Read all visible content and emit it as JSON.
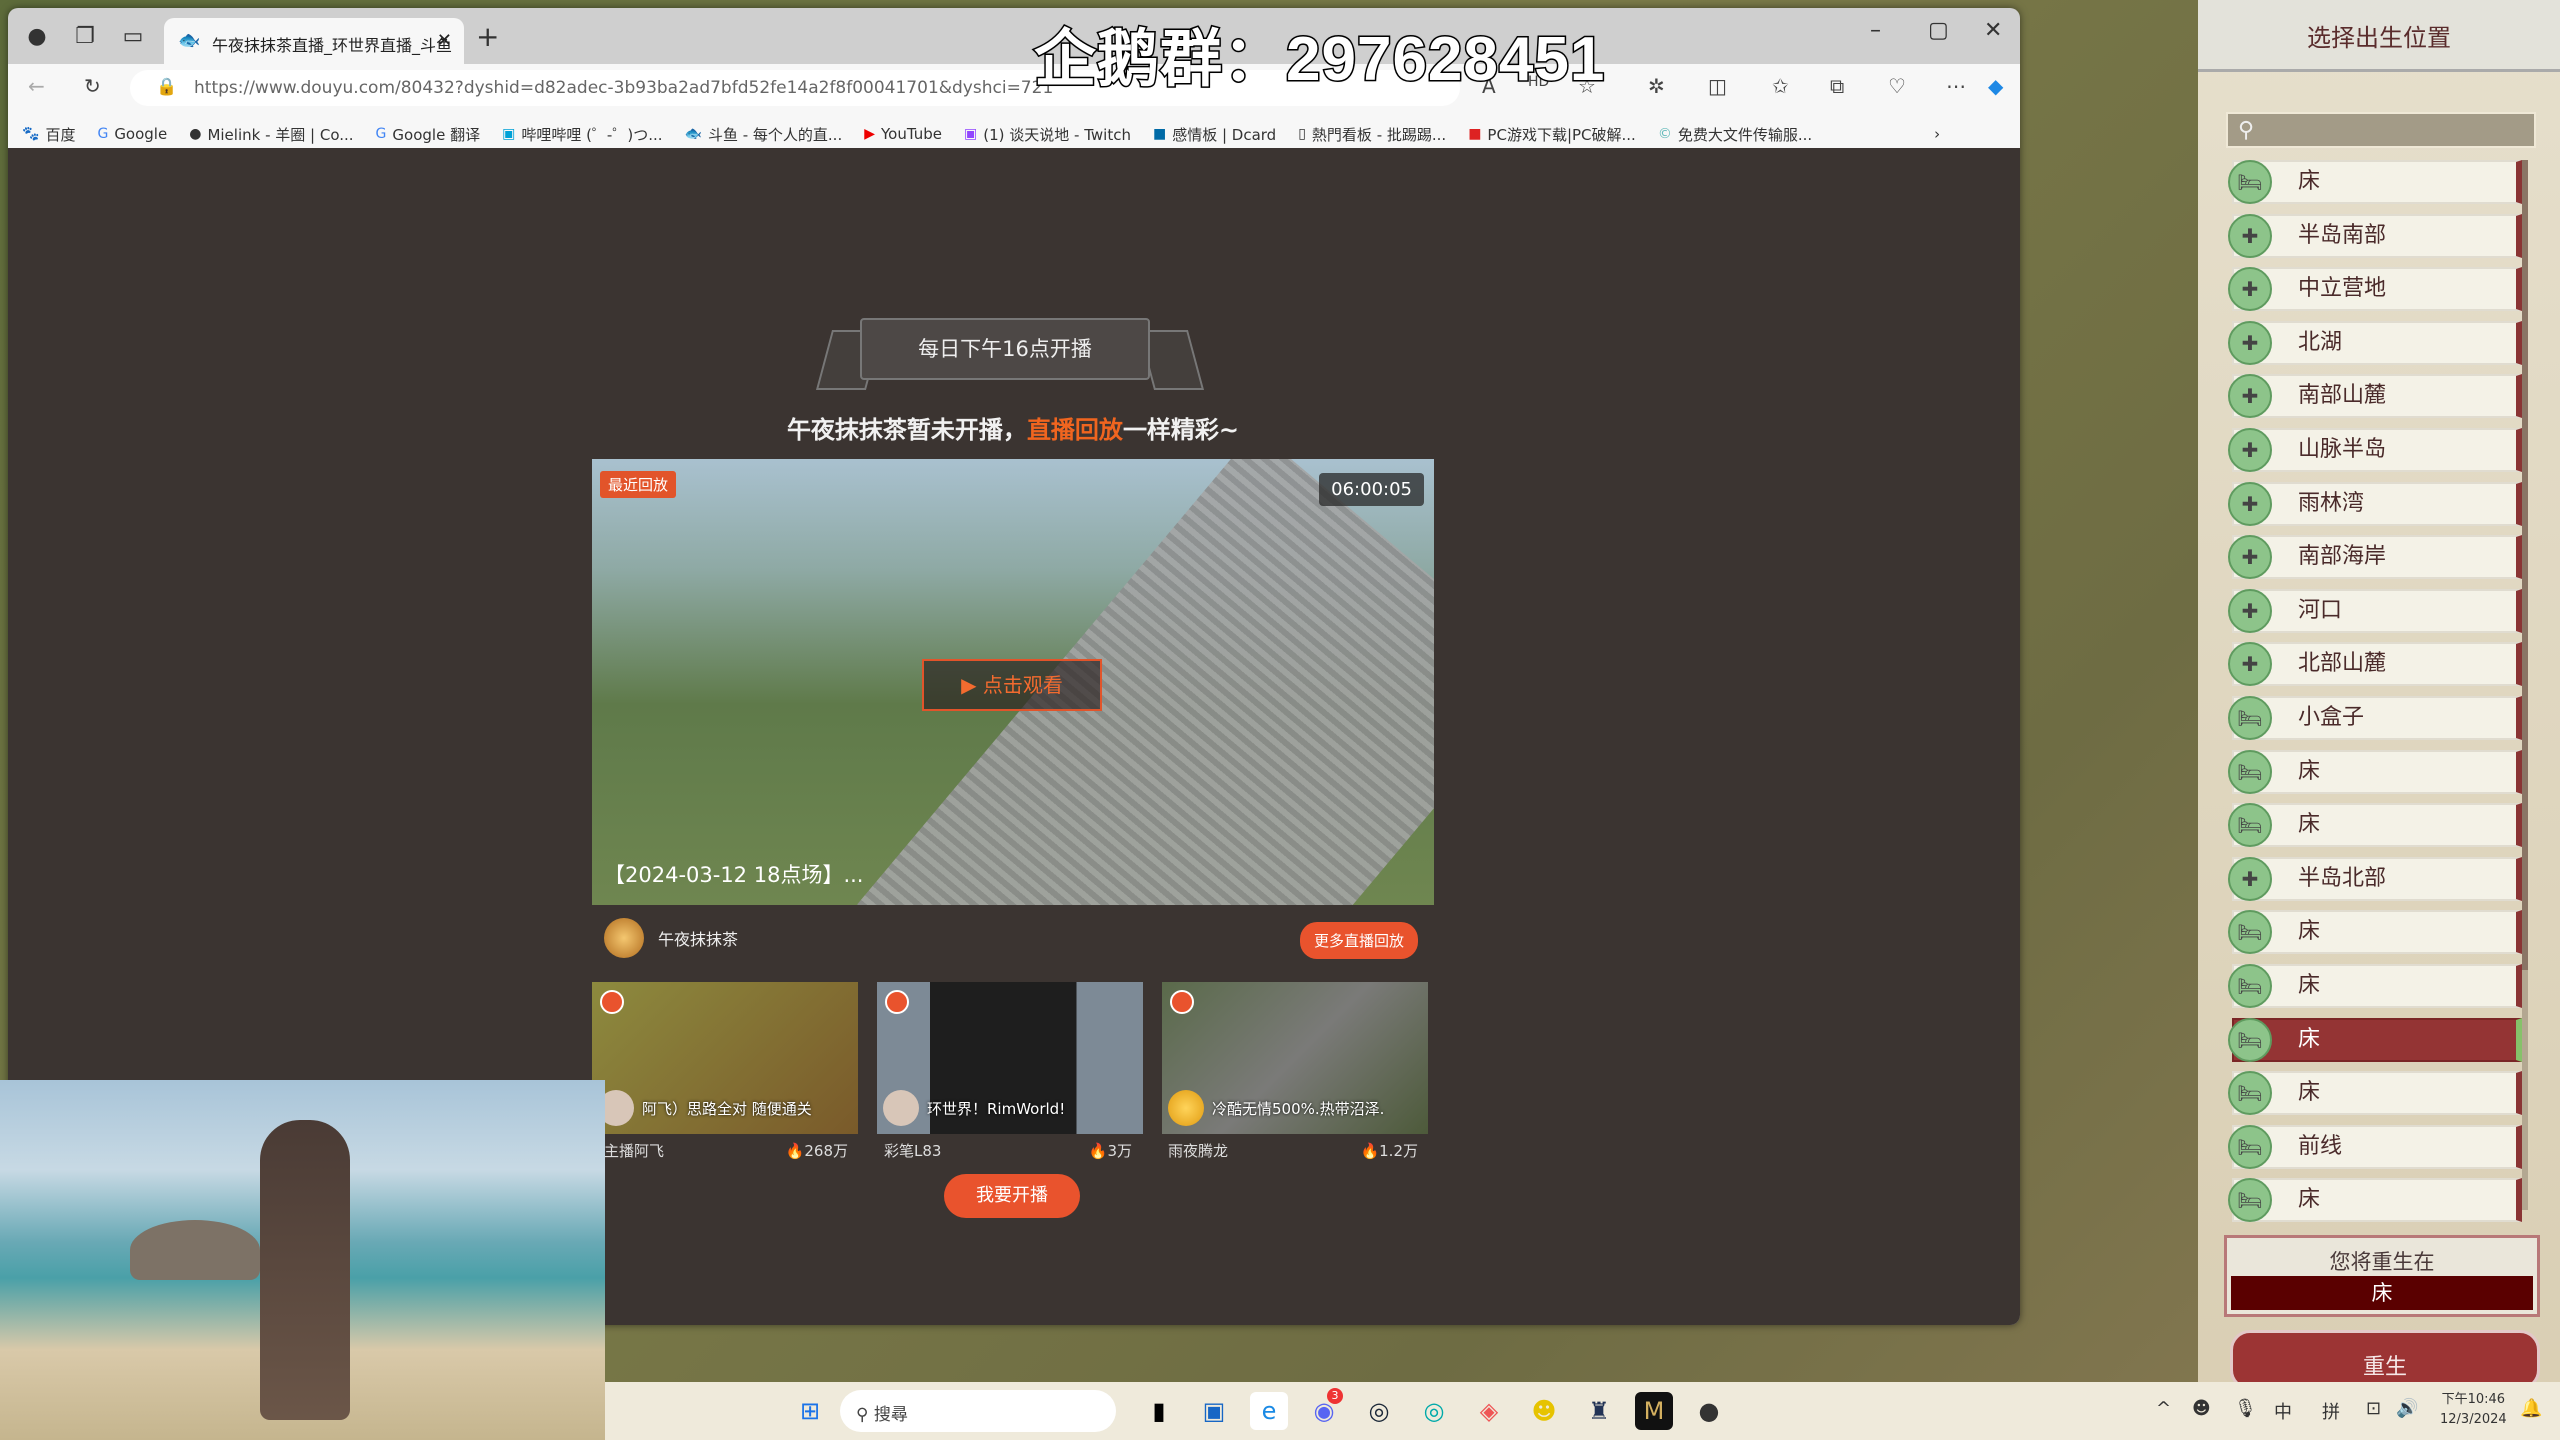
{
  "overlay": {
    "qq_text": "企鹅群：297628451"
  },
  "browser": {
    "tab_title": "午夜抹抹茶直播_环世界直播_斗鱼",
    "url": "https://www.douyu.com/80432?dyshid=d82adec-3b93ba2ad7bfd52fe14a2f8f00041701&dyshci=721",
    "bookmarks": [
      "百度",
      "Google",
      "Mielink - 羊圈 | Co...",
      "Google 翻译",
      "哔哩哔哩 (゜-゜)つ...",
      "斗鱼 - 每个人的直...",
      "YouTube",
      "(1) 谈天说地 - Twitch",
      "感情板 | Dcard",
      "熱門看板 - 批踢踢...",
      "PC游戏下载|PC破解...",
      "免费大文件传输服..."
    ]
  },
  "page": {
    "banner": "每日下午16点开播",
    "notice_prefix": "午夜抹抹茶暂未开播，",
    "notice_highlight": "直播回放",
    "notice_suffix": "一样精彩~",
    "video": {
      "badge": "最近回放",
      "duration": "06:00:05",
      "play_label": "▶ 点击观看",
      "title": "【2024-03-12 18点场】..."
    },
    "streamer": "午夜抹抹茶",
    "more_button": "更多直播回放",
    "cards": [
      {
        "title": "阿飞）思路全对 随便通关",
        "name": "主播阿飞",
        "heat": "268万"
      },
      {
        "title": "环世界！RimWorld!",
        "name": "彩笔L83",
        "heat": "3万"
      },
      {
        "title": "冷酷无情500%.热带沼泽.",
        "name": "雨夜腾龙",
        "heat": "1.2万"
      }
    ],
    "golive_button": "我要开播",
    "accent": "#e9532d"
  },
  "game": {
    "title": "选择出生位置",
    "spawn_points": [
      {
        "label": "床",
        "icon": "bed"
      },
      {
        "label": "半岛南部",
        "icon": "obelisk"
      },
      {
        "label": "中立营地",
        "icon": "obelisk"
      },
      {
        "label": "北湖",
        "icon": "obelisk"
      },
      {
        "label": "南部山麓",
        "icon": "obelisk"
      },
      {
        "label": "山脉半岛",
        "icon": "obelisk"
      },
      {
        "label": "雨林湾",
        "icon": "obelisk"
      },
      {
        "label": "南部海岸",
        "icon": "obelisk"
      },
      {
        "label": "河口",
        "icon": "obelisk"
      },
      {
        "label": "北部山麓",
        "icon": "obelisk"
      },
      {
        "label": "小盒子",
        "icon": "bed"
      },
      {
        "label": "床",
        "icon": "bed"
      },
      {
        "label": "床",
        "icon": "bed"
      },
      {
        "label": "半岛北部",
        "icon": "obelisk"
      },
      {
        "label": "床",
        "icon": "bed"
      },
      {
        "label": "床",
        "icon": "bed"
      },
      {
        "label": "床",
        "icon": "bed",
        "selected": true
      },
      {
        "label": "床",
        "icon": "bed"
      },
      {
        "label": "前线",
        "icon": "bed"
      },
      {
        "label": "床",
        "icon": "bed"
      }
    ],
    "respawn_at_label": "您将重生在",
    "respawn_at_value": "床",
    "respawn_button": "重生"
  },
  "taskbar": {
    "search_placeholder": "搜尋",
    "ime1": "中",
    "ime2": "拼",
    "time": "下午10:46",
    "date": "12/3/2024",
    "discord_badge": "3"
  }
}
